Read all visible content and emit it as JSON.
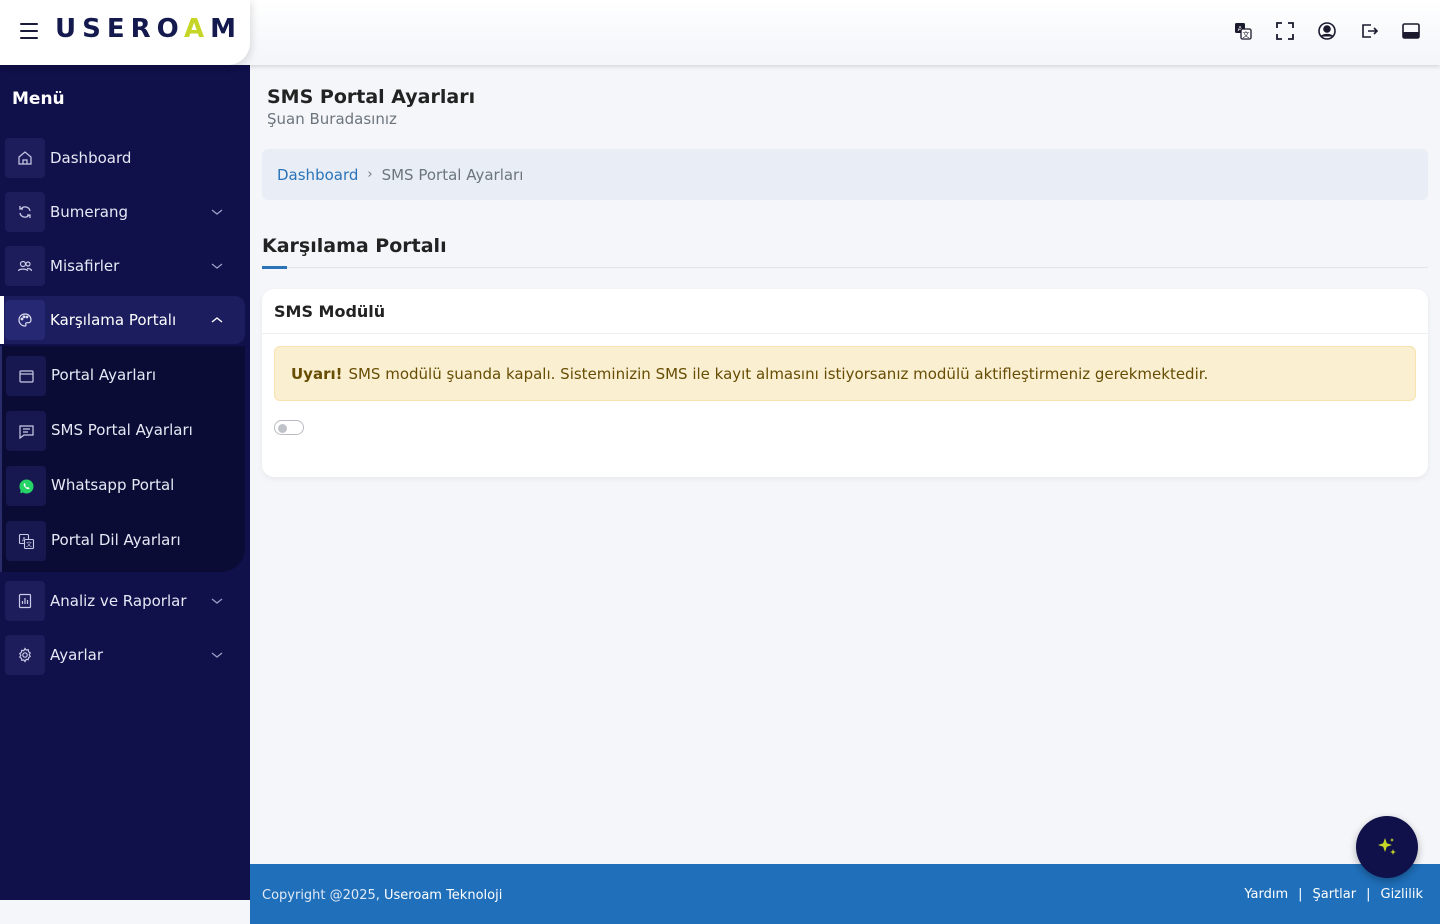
{
  "header": {
    "logo_text_start": "USERO",
    "logo_text_accent": "A",
    "logo_text_end": "M",
    "icons": [
      "translate-icon",
      "fullscreen-icon",
      "user-profile-icon",
      "logout-icon",
      "panel-toggle-icon"
    ]
  },
  "sidebar": {
    "menu_title": "Menü",
    "items": [
      {
        "label": "Dashboard",
        "icon": "home-icon"
      },
      {
        "label": "Bumerang",
        "icon": "refresh-icon"
      },
      {
        "label": "Misafirler",
        "icon": "users-icon"
      },
      {
        "label": "Karşılama Portalı",
        "icon": "palette-icon"
      },
      {
        "label": "Analiz ve Raporlar",
        "icon": "chart-icon"
      },
      {
        "label": "Ayarlar",
        "icon": "gear-icon"
      }
    ],
    "submenu": [
      {
        "label": "Portal Ayarları",
        "icon": "window-icon"
      },
      {
        "label": "SMS Portal Ayarları",
        "icon": "message-icon"
      },
      {
        "label": "Whatsapp Portal",
        "icon": "whatsapp-icon"
      },
      {
        "label": "Portal Dil Ayarları",
        "icon": "translate-icon"
      }
    ],
    "colors": {
      "background": "#10104a",
      "accent": "#c6d629"
    }
  },
  "main": {
    "page_title": "SMS Portal Ayarları",
    "page_subtitle": "Şuan Buradasınız",
    "breadcrumb": {
      "home": "Dashboard",
      "separator": "›",
      "current": "SMS Portal Ayarları"
    },
    "section_title": "Karşılama Portalı",
    "card": {
      "title": "SMS Modülü",
      "alert_strong": "Uyarı!",
      "alert_text": "SMS modülü şuanda kapalı. Sisteminizin SMS ile kayıt almasını istiyorsanız modülü aktifleştirmeniz gerekmektedir.",
      "toggle_state": "off"
    }
  },
  "footer": {
    "copyright": "Copyright @2025,",
    "company": "Useroam Teknoloji",
    "links": [
      "Yardım",
      "Şartlar",
      "Gizlilik"
    ],
    "separator": "|",
    "color": "#1f6fba"
  }
}
